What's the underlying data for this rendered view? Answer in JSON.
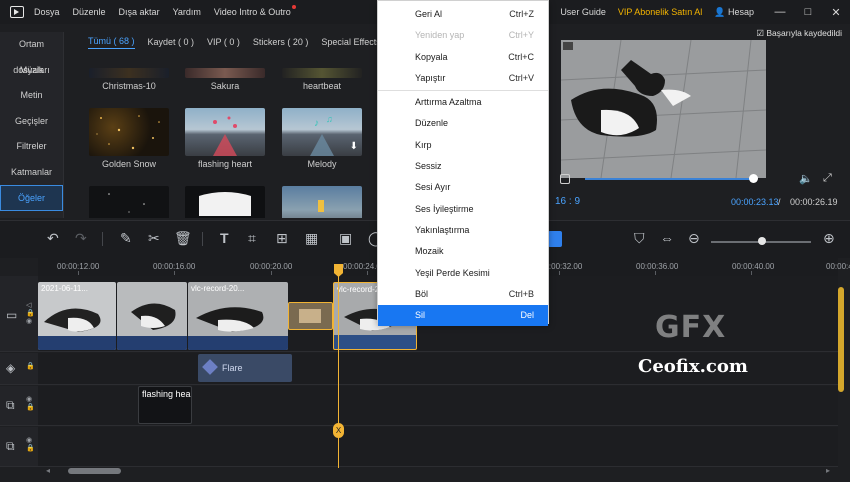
{
  "menubar": {
    "items": [
      "Dosya",
      "Düzenle",
      "Dışa aktar",
      "Yardım",
      "Video Intro & Outro"
    ],
    "user_guide": "User Guide",
    "vip": "VIP Abonelik Satın Al",
    "account": "Hesap",
    "minimize": "—",
    "maximize": "□",
    "close": "✕"
  },
  "sidebar": {
    "items": [
      "Ortam dosyaları",
      "Müzik",
      "Metin",
      "Geçişler",
      "Filtreler",
      "Katmanlar",
      "Öğeler"
    ],
    "active_index": 6
  },
  "library": {
    "tabs": [
      "Tümü ( 68 )",
      "Kaydet ( 0 )",
      "VIP ( 0 )",
      "Stickers ( 20 )",
      "Special Effects ( 2"
    ],
    "active_tab": 0,
    "items": [
      {
        "label": "Christmas-10"
      },
      {
        "label": "Sakura"
      },
      {
        "label": "heartbeat"
      },
      {
        "label": "Golden Snow"
      },
      {
        "label": "flashing heart"
      },
      {
        "label": "Melody"
      }
    ]
  },
  "preview": {
    "saved_text": "Başarıyla kaydedildi",
    "aspect_ratio": "16 : 9",
    "current_time": "00:00:23.13",
    "separator": "/",
    "total_time": "00:00:26.19",
    "progress": 0.97
  },
  "ruler": {
    "labels": [
      "00:00:12.00",
      "00:00:16.00",
      "00:00:20.00",
      "00:00:24.0",
      "00:00:32.00",
      "00:00:36.00",
      "00:00:40.00",
      "00:00:4"
    ]
  },
  "timeline": {
    "clip_names": [
      "2021-06-11...",
      "vlc-record-20...",
      "vlc-record-2...",
      "vlc-record-20..."
    ],
    "effect_clip": "Flare",
    "text_clip": "flashing hea",
    "playhead_marker": "X"
  },
  "context_menu": {
    "groups": [
      [
        {
          "label": "Geri Al",
          "shortcut": "Ctrl+Z",
          "disabled": false
        },
        {
          "label": "Yeniden yap",
          "shortcut": "Ctrl+Y",
          "disabled": true
        },
        {
          "label": "Kopyala",
          "shortcut": "Ctrl+C",
          "disabled": false
        },
        {
          "label": "Yapıştır",
          "shortcut": "Ctrl+V",
          "disabled": false
        }
      ],
      [
        {
          "label": "Arttırma Azaltma",
          "shortcut": ""
        },
        {
          "label": "Düzenle",
          "shortcut": ""
        },
        {
          "label": "Kırp",
          "shortcut": ""
        },
        {
          "label": "Sessiz",
          "shortcut": ""
        },
        {
          "label": "Sesi Ayır",
          "shortcut": ""
        },
        {
          "label": "Ses İyileştirme",
          "shortcut": ""
        },
        {
          "label": "Yakınlaştırma",
          "shortcut": ""
        },
        {
          "label": "Mozaik",
          "shortcut": ""
        },
        {
          "label": "Yeşil Perde Kesimi",
          "shortcut": ""
        },
        {
          "label": "Böl",
          "shortcut": "Ctrl+B"
        },
        {
          "label": "Sil",
          "shortcut": "Del",
          "active": true
        }
      ]
    ]
  },
  "watermark": {
    "logo": "GFX",
    "text": "Ceofix.com"
  },
  "colors": {
    "accent": "#4aa3ff",
    "vip": "#f4b400",
    "playhead": "#f2b434",
    "menu_highlight": "#1877f2"
  }
}
